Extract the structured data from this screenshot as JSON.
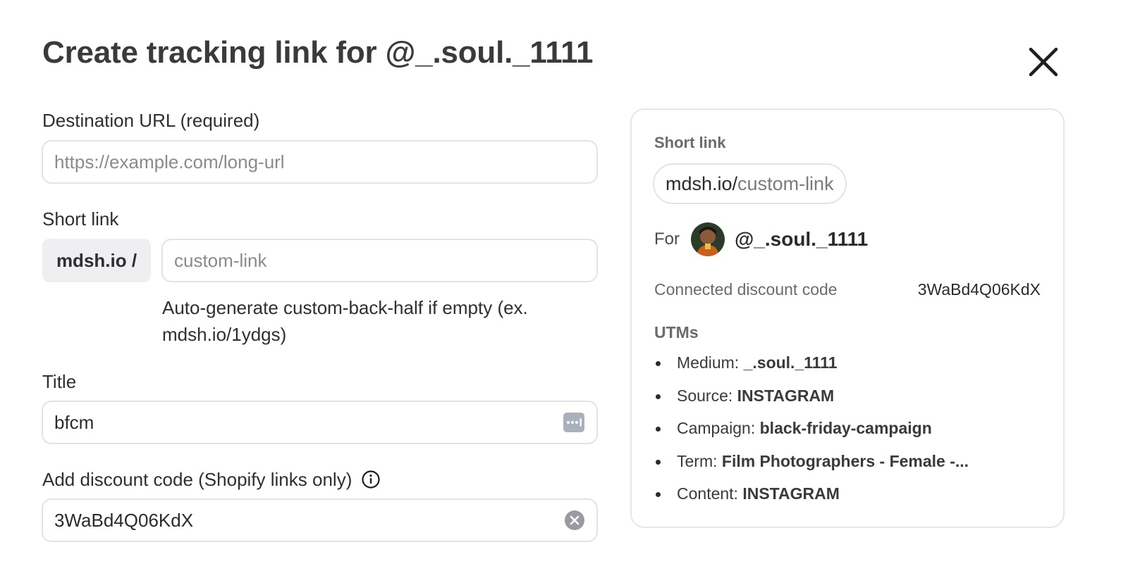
{
  "modal": {
    "title": "Create tracking link for @_.soul._1111"
  },
  "form": {
    "destination": {
      "label": "Destination URL (required)",
      "placeholder": "https://example.com/long-url",
      "value": ""
    },
    "short_link": {
      "label": "Short link",
      "prefix": "mdsh.io /",
      "placeholder": "custom-link",
      "value": "",
      "hint": "Auto-generate custom-back-half if empty (ex. mdsh.io/1ydgs)"
    },
    "title": {
      "label": "Title",
      "value": "bfcm",
      "icon": "password-manager-icon"
    },
    "discount": {
      "label": "Add discount code (Shopify links only)",
      "value": "3WaBd4Q06KdX",
      "info_icon": "info-icon",
      "clear_icon": "clear-icon"
    }
  },
  "preview": {
    "short_link_caption": "Short link",
    "short_link_base": "mdsh.io/",
    "short_link_slug": "custom-link",
    "for_label": "For",
    "handle": "@_.soul._1111",
    "discount_label": "Connected discount code",
    "discount_value": "3WaBd4Q06KdX",
    "utms_caption": "UTMs",
    "utms": [
      {
        "key": "Medium:",
        "value": "_.soul._1111"
      },
      {
        "key": "Source:",
        "value": "INSTAGRAM"
      },
      {
        "key": "Campaign:",
        "value": "black-friday-campaign"
      },
      {
        "key": "Term:",
        "value": "Film Photographers - Female -..."
      },
      {
        "key": "Content:",
        "value": "INSTAGRAM"
      }
    ]
  },
  "colors": {
    "border": "#e3e3e7",
    "prefix_bg": "#efeff1",
    "muted_text": "#6a6a70"
  }
}
